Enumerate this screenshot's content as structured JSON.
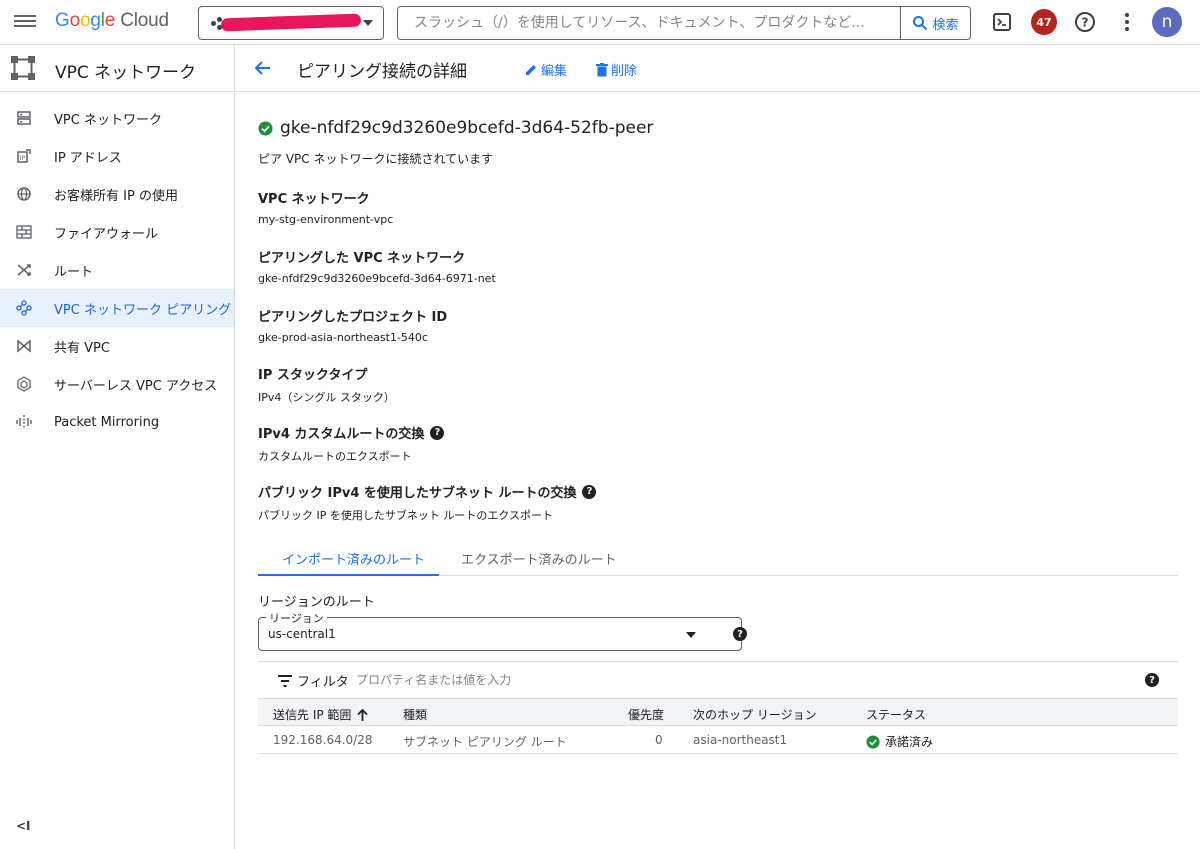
{
  "header": {
    "logo": {
      "g": "G",
      "o1": "o",
      "o2": "o",
      "g2": "g",
      "l": "l",
      "e": "e",
      "cloud": " Cloud"
    },
    "search_placeholder": "スラッシュ（/）を使用してリソース、ドキュメント、プロダクトなど...",
    "search_button": "検索",
    "notification_count": "47",
    "avatar_initial": "n"
  },
  "sidebar": {
    "title": "VPC ネットワーク",
    "items": [
      {
        "label": "VPC ネットワーク",
        "icon": "vpc-network-icon"
      },
      {
        "label": "IP アドレス",
        "icon": "ip-address-icon"
      },
      {
        "label": "お客様所有 IP の使用",
        "icon": "globe-ip-icon"
      },
      {
        "label": "ファイアウォール",
        "icon": "firewall-icon"
      },
      {
        "label": "ルート",
        "icon": "routes-icon"
      },
      {
        "label": "VPC ネットワーク ピアリング",
        "icon": "peering-icon",
        "active": true
      },
      {
        "label": "共有 VPC",
        "icon": "shared-vpc-icon"
      },
      {
        "label": "サーバーレス VPC アクセス",
        "icon": "serverless-icon"
      },
      {
        "label": "Packet Mirroring",
        "icon": "packet-mirroring-icon"
      }
    ],
    "collapse_label": "<I"
  },
  "page": {
    "title": "ピアリング接続の詳細",
    "edit_label": "編集",
    "delete_label": "削除"
  },
  "peering": {
    "name": "gke-nfdf29c9d3260e9bcefd-3d64-52fb-peer",
    "status_text": "ピア VPC ネットワークに接続されています",
    "fields": [
      {
        "label": "VPC ネットワーク",
        "value": "my-stg-environment-vpc"
      },
      {
        "label": "ピアリングした VPC ネットワーク",
        "value": "gke-nfdf29c9d3260e9bcefd-3d64-6971-net"
      },
      {
        "label": "ピアリングしたプロジェクト ID",
        "value": "gke-prod-asia-northeast1-540c"
      },
      {
        "label": "IP スタックタイプ",
        "value": "IPv4（シングル スタック）"
      },
      {
        "label": "IPv4 カスタムルートの交換",
        "value": "カスタムルートのエクスポート"
      },
      {
        "label": "パブリック IPv4 を使用したサブネット ルートの交換",
        "value": "パブリック IP を使用したサブネット ルートのエクスポート"
      }
    ]
  },
  "tabs": [
    "インポート済みのルート",
    "エクスポート済みのルート"
  ],
  "routes": {
    "section_title": "リージョンのルート",
    "region_label": "リージョン",
    "region_value": "us-central1",
    "filter_label": "フィルタ",
    "filter_placeholder": "プロパティ名または値を入力",
    "columns": [
      "送信先 IP 範囲",
      "種類",
      "優先度",
      "次のホップ リージョン",
      "ステータス"
    ],
    "rows": [
      {
        "dest": "192.168.64.0/28",
        "type": "サブネット ピアリング ルート",
        "priority": "0",
        "next_hop_region": "asia-northeast1",
        "status": "承諾済み"
      }
    ]
  },
  "colors": {
    "accent": "#1a73e8",
    "success": "#1e8e3e",
    "badge": "#b3261e",
    "avatar": "#5c6bc0"
  }
}
